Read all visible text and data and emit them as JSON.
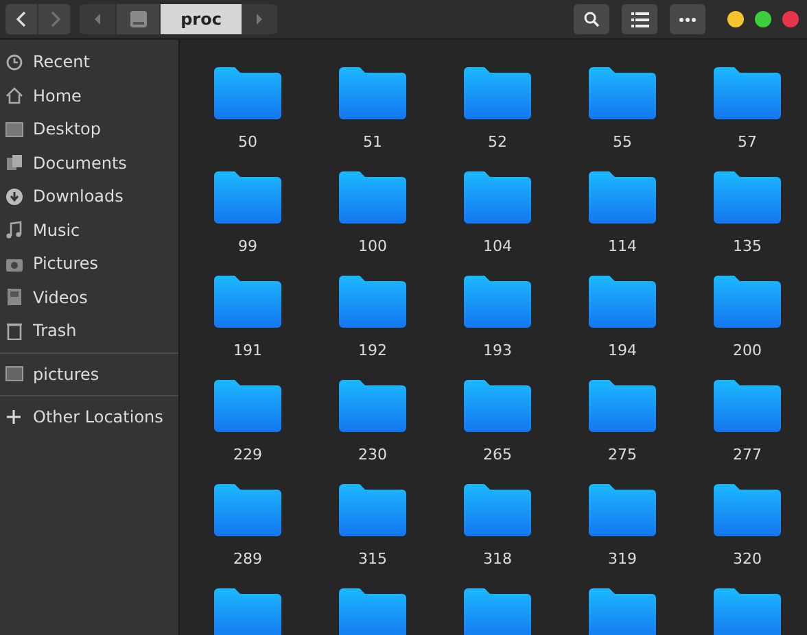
{
  "toolbar": {
    "back": {
      "disabled": false
    },
    "forward": {
      "disabled": true
    },
    "path": [
      {
        "kind": "drive",
        "selected": false
      },
      {
        "kind": "text",
        "label": "proc",
        "selected": true
      }
    ]
  },
  "sidebar": {
    "sections": [
      {
        "items": [
          {
            "label": "Recent",
            "selected": false
          },
          {
            "label": "Home",
            "selected": false
          },
          {
            "label": "Desktop",
            "selected": false
          },
          {
            "label": "Documents",
            "selected": false
          },
          {
            "label": "Downloads",
            "selected": false
          },
          {
            "label": "Music",
            "selected": false
          },
          {
            "label": "Pictures",
            "selected": false
          },
          {
            "label": "Videos",
            "selected": false
          },
          {
            "label": "Trash",
            "selected": false
          }
        ]
      },
      {
        "items": [
          {
            "label": "pictures",
            "selected": false
          }
        ]
      },
      {
        "items": [
          {
            "label": "Other Locations",
            "selected": false
          }
        ]
      }
    ]
  },
  "folders": [
    {
      "name": "50"
    },
    {
      "name": "51"
    },
    {
      "name": "52"
    },
    {
      "name": "55"
    },
    {
      "name": "57"
    },
    {
      "name": "99"
    },
    {
      "name": "100"
    },
    {
      "name": "104"
    },
    {
      "name": "114"
    },
    {
      "name": "135"
    },
    {
      "name": "191"
    },
    {
      "name": "192"
    },
    {
      "name": "193"
    },
    {
      "name": "194"
    },
    {
      "name": "200"
    },
    {
      "name": "229"
    },
    {
      "name": "230"
    },
    {
      "name": "265"
    },
    {
      "name": "275"
    },
    {
      "name": "277"
    },
    {
      "name": "289"
    },
    {
      "name": "315"
    },
    {
      "name": "318"
    },
    {
      "name": "319"
    },
    {
      "name": "320"
    }
  ]
}
